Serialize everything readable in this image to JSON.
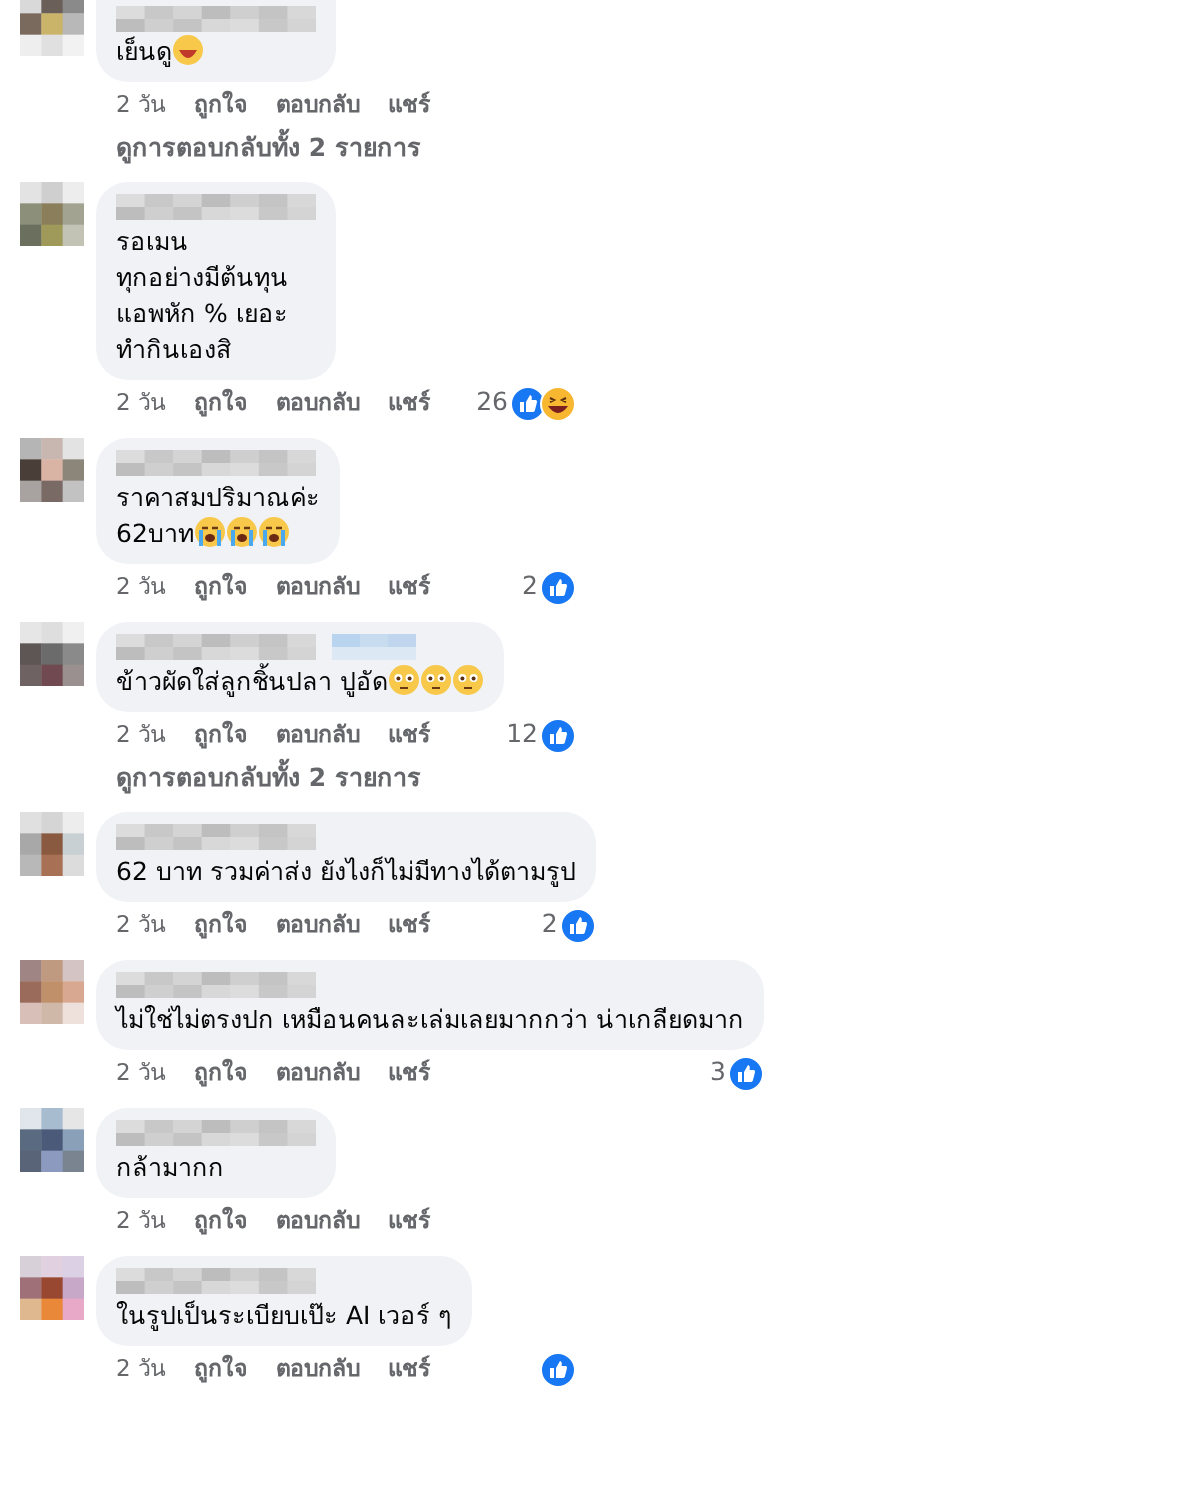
{
  "comments": [
    {
      "text": "เย็นดู",
      "emoji": {
        "kind": "laughing"
      },
      "name_badge": false,
      "time": "2 วัน",
      "actions": [
        "ถูกใจ",
        "ตอบกลับ",
        "แชร์"
      ],
      "replies_link": "ดูการตอบกลับทั้ง 2 รายการ",
      "cut_top": true
    },
    {
      "text": "รอเมน\nทุกอย่างมีต้นทุน\nแอพหัก % เยอะ\nทำกินเองสิ",
      "name_badge": false,
      "time": "2 วัน",
      "actions": [
        "ถูกใจ",
        "ตอบกลับ",
        "แชร์"
      ],
      "reaction_count": "26",
      "reaction": {
        "kind": "like"
      },
      "second_reaction": {
        "kind": "haha"
      },
      "cut_top": false
    },
    {
      "text": "ราคาสมปริมาณค่ะ\n62บาท",
      "emoji": {
        "kind": "crying"
      },
      "name_badge": false,
      "time": "2 วัน",
      "actions": [
        "ถูกใจ",
        "ตอบกลับ",
        "แชร์"
      ],
      "reaction_count": "2",
      "reaction": {
        "kind": "like"
      },
      "cut_top": false
    },
    {
      "text": "ข้าวผัดใส่ลูกชิ้นปลา ปูอัด",
      "emoji": {
        "kind": "flushed"
      },
      "name_badge": true,
      "time": "2 วัน",
      "actions": [
        "ถูกใจ",
        "ตอบกลับ",
        "แชร์"
      ],
      "reaction_count": "12",
      "reaction": {
        "kind": "like"
      },
      "replies_link": "ดูการตอบกลับทั้ง 2 รายการ",
      "cut_top": false
    },
    {
      "text": "62 บาท รวมค่าส่ง ยังไงก็ไม่มีทางได้ตามรูป",
      "name_badge": false,
      "time": "2 วัน",
      "actions": [
        "ถูกใจ",
        "ตอบกลับ",
        "แชร์"
      ],
      "reaction_count": "2",
      "reaction": {
        "kind": "like"
      },
      "cut_top": false
    },
    {
      "text": "ไม่ใช่ไม่ตรงปก เหมือนคนละเล่มเลยมากกว่า น่าเกลียดมาก",
      "name_badge": false,
      "time": "2 วัน",
      "actions": [
        "ถูกใจ",
        "ตอบกลับ",
        "แชร์"
      ],
      "reaction_count": "3",
      "reaction": {
        "kind": "like"
      },
      "cut_top": false
    },
    {
      "text": "กล้ามากก",
      "name_badge": false,
      "time": "2 วัน",
      "actions": [
        "ถูกใจ",
        "ตอบกลับ",
        "แชร์"
      ],
      "cut_top": false
    },
    {
      "text": "ในรูปเป็นระเบียบเป๊ะ AI เวอร์ ๆ",
      "name_badge": false,
      "time": "2 วัน",
      "actions": [
        "ถูกใจ",
        "ตอบกลับ",
        "แชร์"
      ],
      "reaction": {
        "kind": "like"
      },
      "cut_top": false
    }
  ]
}
